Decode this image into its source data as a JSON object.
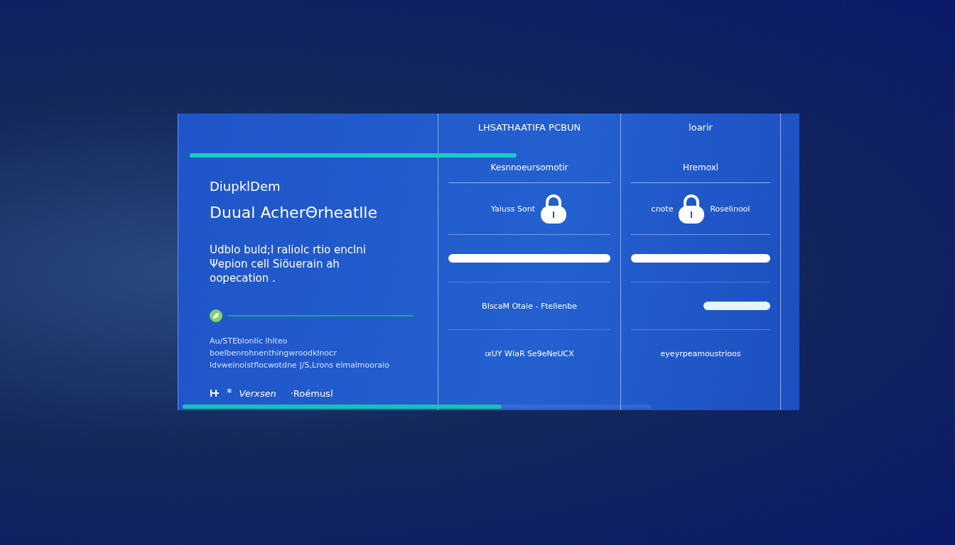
{
  "panel": {
    "eyebrow": "DiupklDem",
    "title": "Duual AcherΘrheatlle",
    "description": "Udblo buld;l raliolc rtio enclni Ψepion cell Siöuerain ah oopecation .",
    "note": "Au/STEblonlic lhiteo boelbenrohnenthingwroodklnocr ldvweinolstflocwotdne |/S,Lrons elmalmooraio",
    "footer": {
      "star": "*",
      "label": "Verxsen",
      "link": "·Roémusl"
    },
    "progress": {
      "level": 0.68
    }
  },
  "columns": [
    {
      "header": "LHSATHAATIFA PCBUN",
      "subheader": "Kesnnoeursomotir",
      "lock_labels": [
        "Yaiuss Sont"
      ],
      "rows": [
        {
          "kind": "bar"
        },
        {
          "kind": "text",
          "text": "BIscaM Otaie - Ftellenbe"
        },
        {
          "kind": "text",
          "text": "ıxUY WIaR Se9eNeUCX"
        }
      ]
    },
    {
      "header": "loarir",
      "subheader": "Hremoxl",
      "lock_labels": [
        "cnote",
        "Roselinool"
      ],
      "rows": [
        {
          "kind": "bar"
        },
        {
          "kind": "short-bar"
        },
        {
          "kind": "text",
          "text": "eyeyrpeamoustrioos"
        }
      ]
    }
  ]
}
